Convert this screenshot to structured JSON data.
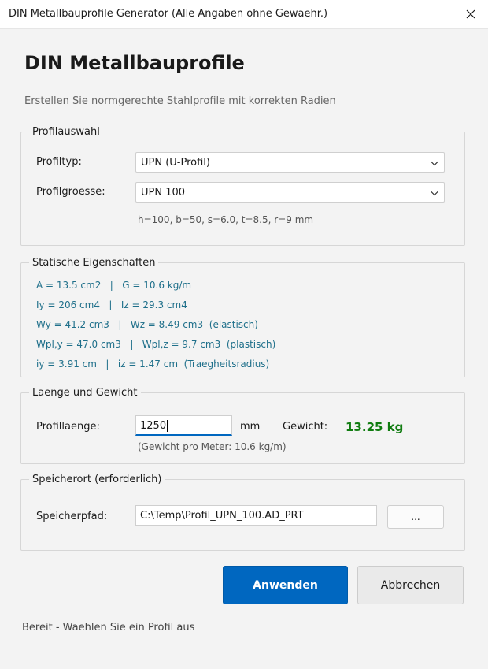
{
  "window": {
    "title": "DIN Metallbauprofile Generator (Alle Angaben ohne Gewaehr.)"
  },
  "header": {
    "heading": "DIN Metallbauprofile",
    "subtitle": "Erstellen Sie normgerechte Stahlprofile mit korrekten Radien"
  },
  "profile_selection": {
    "legend": "Profilauswahl",
    "type_label": "Profiltyp:",
    "type_value": "UPN (U-Profil)",
    "size_label": "Profilgroesse:",
    "size_value": "UPN 100",
    "dimensions": "h=100, b=50, s=6.0, t=8.5, r=9 mm"
  },
  "static_properties": {
    "legend": "Statische Eigenschaften",
    "lines": [
      "A = 13.5 cm2   |   G = 10.6 kg/m",
      "Iy = 206 cm4   |   Iz = 29.3 cm4",
      "Wy = 41.2 cm3   |   Wz = 8.49 cm3  (elastisch)",
      "Wpl,y = 47.0 cm3   |   Wpl,z = 9.7 cm3  (plastisch)",
      "iy = 3.91 cm   |   iz = 1.47 cm  (Traegheitsradius)"
    ]
  },
  "length_weight": {
    "legend": "Laenge und Gewicht",
    "length_label": "Profillaenge:",
    "length_value": "1250",
    "unit": "mm",
    "weight_label": "Gewicht:",
    "weight_value": "13.25 kg",
    "weight_note": "(Gewicht pro Meter: 10.6 kg/m)"
  },
  "storage": {
    "legend": "Speicherort (erforderlich)",
    "path_label": "Speicherpfad:",
    "path_value": "C:\\Temp\\Profil_UPN_100.AD_PRT",
    "browse_label": "..."
  },
  "actions": {
    "apply_label": "Anwenden",
    "cancel_label": "Abbrechen"
  },
  "status": "Bereit - Waehlen Sie ein Profil aus",
  "colors": {
    "accent": "#0067c0",
    "weight": "#107c10",
    "property_text": "#1e6f8a"
  }
}
